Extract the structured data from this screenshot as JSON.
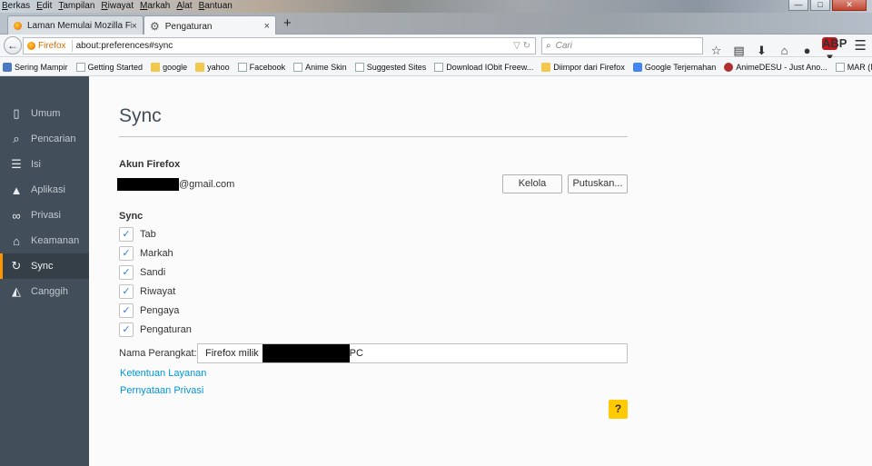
{
  "menubar": [
    "Berkas",
    "Edit",
    "Tampilan",
    "Riwayat",
    "Markah",
    "Alat",
    "Bantuan"
  ],
  "window_controls": {
    "minimize": "—",
    "maximize": "□",
    "close": "✕"
  },
  "tabs": [
    {
      "label": "Laman Memulai Mozilla Fir...",
      "icon": "firefox-icon",
      "close": "×"
    },
    {
      "label": "Pengaturan",
      "icon": "gear-icon",
      "close": "×"
    }
  ],
  "new_tab": "+",
  "navbar": {
    "identity": "Firefox",
    "url": "about:preferences#sync",
    "search_placeholder": "Cari"
  },
  "bookmarks": [
    {
      "label": "Sering Mampir",
      "icon": "star"
    },
    {
      "label": "Getting Started",
      "icon": "page"
    },
    {
      "label": "google",
      "icon": "folder"
    },
    {
      "label": "yahoo",
      "icon": "folder"
    },
    {
      "label": "Facebook",
      "icon": "page"
    },
    {
      "label": "Anime Skin",
      "icon": "page"
    },
    {
      "label": "Suggested Sites",
      "icon": "page"
    },
    {
      "label": "Download IObit Freew...",
      "icon": "page"
    },
    {
      "label": "Diimpor dari Firefox",
      "icon": "folder"
    },
    {
      "label": "Google Terjemahan",
      "icon": "g"
    },
    {
      "label": "AnimeDESU - Just Ano...",
      "icon": "anime"
    },
    {
      "label": "MAR (Marchen Awake...",
      "icon": "page"
    }
  ],
  "sidebar": {
    "items": [
      {
        "label": "Umum",
        "icon": "general-icon",
        "glyph": "▯"
      },
      {
        "label": "Pencarian",
        "icon": "search-icon",
        "glyph": "⌕"
      },
      {
        "label": "Isi",
        "icon": "content-icon",
        "glyph": "☰"
      },
      {
        "label": "Aplikasi",
        "icon": "applications-icon",
        "glyph": "▲"
      },
      {
        "label": "Privasi",
        "icon": "privacy-mask-icon",
        "glyph": "∞"
      },
      {
        "label": "Keamanan",
        "icon": "security-icon",
        "glyph": "⌂"
      },
      {
        "label": "Sync",
        "icon": "sync-icon",
        "glyph": "↻",
        "selected": true
      },
      {
        "label": "Canggih",
        "icon": "advanced-icon",
        "glyph": "◭"
      }
    ]
  },
  "main": {
    "title": "Sync",
    "account_heading": "Akun Firefox",
    "email_suffix": "@gmail.com",
    "manage_button": "Kelola",
    "disconnect_button": "Putuskan...",
    "sync_heading": "Sync",
    "sync_options": [
      {
        "label": "Tab",
        "checked": true
      },
      {
        "label": "Markah",
        "checked": true
      },
      {
        "label": "Sandi",
        "checked": true
      },
      {
        "label": "Riwayat",
        "checked": true
      },
      {
        "label": "Pengaya",
        "checked": true
      },
      {
        "label": "Pengaturan",
        "checked": true
      }
    ],
    "checkmark": "✓",
    "device_label": "Nama Perangkat:",
    "device_name_prefix": "Firefox milik",
    "device_name_suffix": "PC",
    "terms_link": "Ketentuan Layanan",
    "privacy_link": "Pernyataan Privasi",
    "help_button": "?"
  },
  "colors": {
    "sidebar_bg": "#424f5a",
    "selected_accent": "#ff9500",
    "link": "#0095dd",
    "check": "#297fd5",
    "help": "#ffcb00"
  }
}
